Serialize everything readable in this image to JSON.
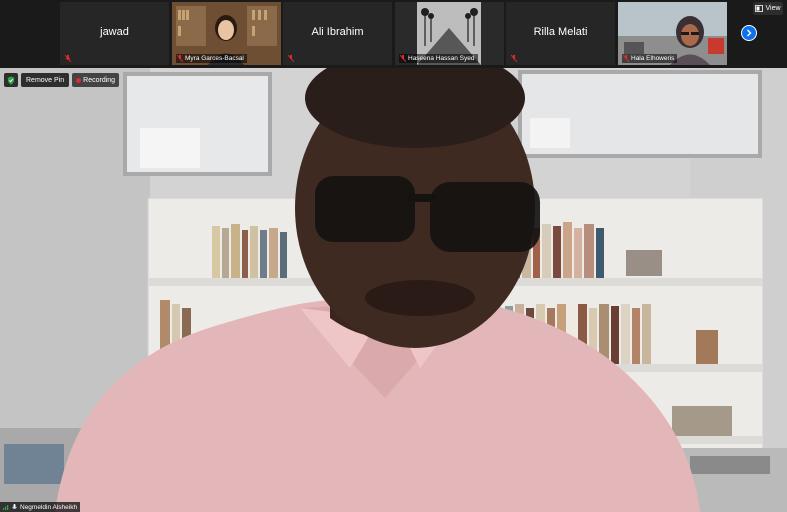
{
  "participants": [
    {
      "name": "jawad",
      "video": false
    },
    {
      "name": "Myra Garces-Bacsal",
      "video": true
    },
    {
      "name": "Ali Ibrahim",
      "video": false
    },
    {
      "name": "Haseena Hassan Syed",
      "video": true
    },
    {
      "name": "Rilla Melati",
      "video": false
    },
    {
      "name": "Hala Elhoweris",
      "video": true
    }
  ],
  "toolbar": {
    "view_label": "View",
    "remove_pin_label": "Remove Pin",
    "recording_label": "Recording"
  },
  "main": {
    "speaker_name": "Negmeldin Alsheikh"
  },
  "colors": {
    "strip_bg": "#1a1a1a",
    "tile_bg": "#262626",
    "accent_blue": "#0e72ed",
    "mute_red": "#e0282e"
  },
  "icons": [
    "view-icon",
    "next-page-icon",
    "shield-icon",
    "recording-dot-icon",
    "mic-muted-icon",
    "signal-icon",
    "mic-icon"
  ]
}
